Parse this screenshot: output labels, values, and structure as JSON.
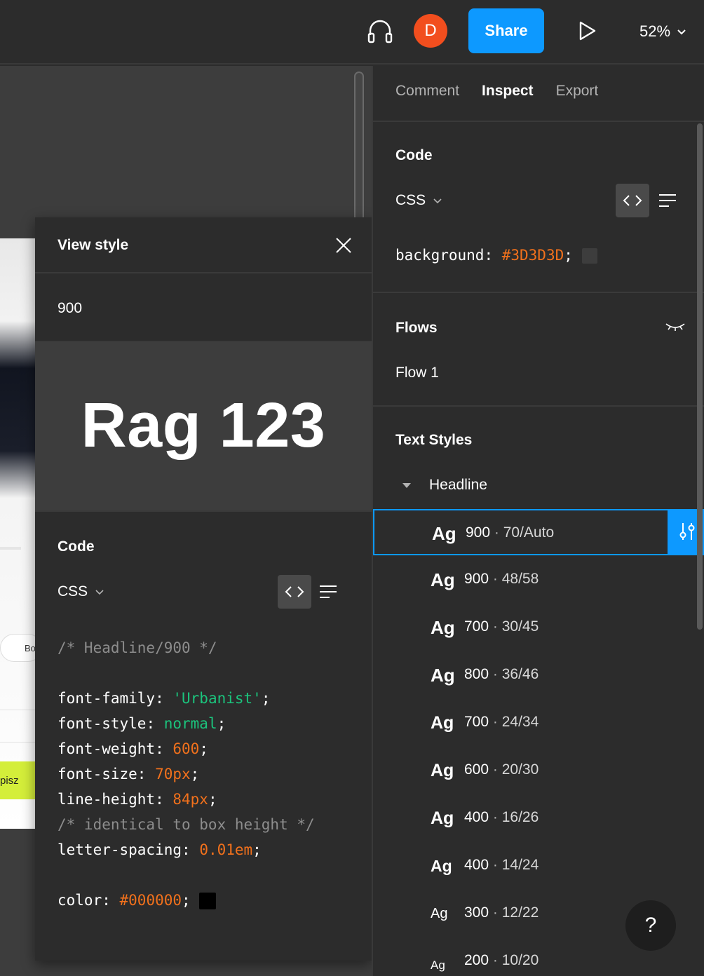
{
  "toolbar": {
    "avatar_initial": "D",
    "share_label": "Share",
    "zoom_level": "52%"
  },
  "canvas": {
    "art_chip_text": "Bo",
    "art_button_text": "pisz"
  },
  "view_style": {
    "title": "View style",
    "style_name": "900",
    "preview_text": "Rag 123",
    "code_title": "Code",
    "language": "CSS",
    "code": {
      "comment": "/* Headline/900 */",
      "font_family_prop": "font-family",
      "font_family_val": "'Urbanist'",
      "font_style_prop": "font-style",
      "font_style_val": "normal",
      "font_weight_prop": "font-weight",
      "font_weight_val": "600",
      "font_size_prop": "font-size",
      "font_size_val": "70px",
      "line_height_prop": "line-height",
      "line_height_val": "84px",
      "line_height_comment": "/* identical to box height */",
      "letter_spacing_prop": "letter-spacing",
      "letter_spacing_val": "0.01em",
      "color_prop": "color",
      "color_val": "#000000"
    }
  },
  "inspect": {
    "tabs": [
      {
        "label": "Comment",
        "active": false
      },
      {
        "label": "Inspect",
        "active": true
      },
      {
        "label": "Export",
        "active": false
      }
    ],
    "code_title": "Code",
    "language": "CSS",
    "background_prop": "background",
    "background_val": "#3D3D3D",
    "flows_title": "Flows",
    "flow_item": "Flow 1",
    "text_styles_title": "Text Styles",
    "group_name": "Headline",
    "ag_label": "Ag",
    "text_styles": [
      {
        "weight": "900",
        "size_lh": "70/Auto",
        "selected": true
      },
      {
        "weight": "900",
        "size_lh": "48/58",
        "selected": false
      },
      {
        "weight": "700",
        "size_lh": "30/45",
        "selected": false
      },
      {
        "weight": "800",
        "size_lh": "36/46",
        "selected": false
      },
      {
        "weight": "700",
        "size_lh": "24/34",
        "selected": false
      },
      {
        "weight": "600",
        "size_lh": "20/30",
        "selected": false
      },
      {
        "weight": "400",
        "size_lh": "16/26",
        "selected": false
      },
      {
        "weight": "400",
        "size_lh": "14/24",
        "selected": false
      },
      {
        "weight": "300",
        "size_lh": "12/22",
        "selected": false
      },
      {
        "weight": "200",
        "size_lh": "10/20",
        "selected": false
      }
    ],
    "separator": "·",
    "help_label": "?"
  },
  "colors": {
    "accent": "#0d99ff",
    "avatar": "#f24e1e",
    "code_orange": "#f2711c",
    "code_green": "#1bc47d",
    "swatch_bg": "#3D3D3D",
    "swatch_color": "#000000"
  }
}
